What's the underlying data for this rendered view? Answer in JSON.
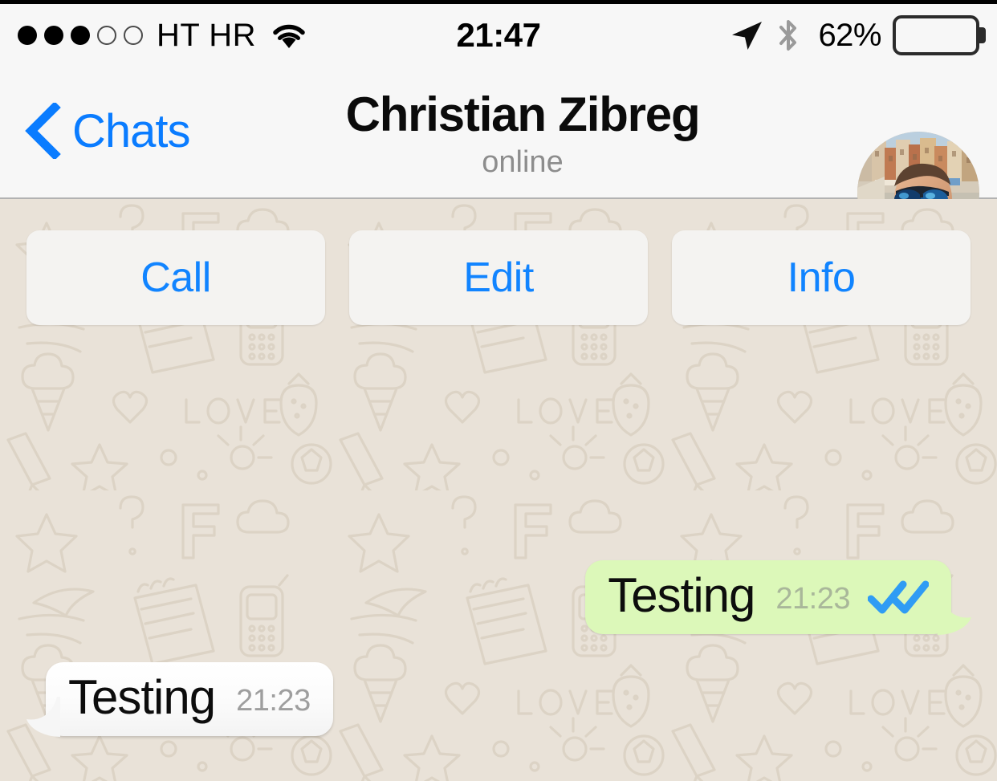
{
  "status_bar": {
    "signal_dots_filled": 3,
    "signal_dots_total": 5,
    "carrier": "HT HR",
    "wifi_icon": "wifi-icon",
    "time": "21:47",
    "location_icon": "location-arrow-icon",
    "bluetooth_icon": "bluetooth-icon",
    "battery_percent": "62%",
    "battery_level": 62
  },
  "nav_bar": {
    "back_label": "Chats",
    "back_icon": "chevron-left-icon",
    "title": "Christian Zibreg",
    "subtitle": "online",
    "avatar_alt": "contact-avatar"
  },
  "actions": [
    {
      "label": "Call",
      "name": "call-button"
    },
    {
      "label": "Edit",
      "name": "edit-button"
    },
    {
      "label": "Info",
      "name": "info-button"
    }
  ],
  "messages": [
    {
      "text": "Testing",
      "time": "21:23",
      "direction": "outgoing",
      "status": "read",
      "status_icon": "double-check-icon"
    },
    {
      "text": "Testing",
      "time": "21:23",
      "direction": "incoming",
      "status": "",
      "status_icon": ""
    }
  ],
  "colors": {
    "accent_blue": "#0a7cff",
    "button_blue": "#1184ff",
    "outgoing_bubble": "#dcf8b9",
    "incoming_bubble": "#ffffff",
    "chat_background": "#e9e2d8",
    "doodle_stroke": "#d7cdbf",
    "nav_background": "#f7f7f7",
    "read_tick_blue": "#2f9cf4",
    "subtitle_gray": "#8d8d8d"
  }
}
